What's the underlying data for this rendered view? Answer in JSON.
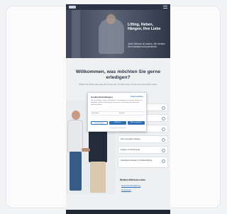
{
  "hero": {
    "title": "Lifting, Heben, Hängen, Ihre Liebe",
    "subtitle": "Jeder Mensch ist anders. Wir beraten Sie individuell und persönlich."
  },
  "main": {
    "welcome": "Willkommen, was möchten Sie gerne erledigen?",
    "intro": "Wählen Sie einfach das passende Thema aus, wir helfen Ihnen schnell und unkompliziert weiter."
  },
  "options": [
    {
      "label": "Beratungstermin vereinbaren"
    },
    {
      "label": "Rückruf anfordern"
    },
    {
      "label": "Unterlagen einreichen"
    },
    {
      "label": "Ihren Kontakt mitteilen"
    },
    {
      "label": "Fragen zur Rechnung"
    },
    {
      "label": "Sonstiges Anliegen zur Behandlung"
    }
  ],
  "links": {
    "heading": "Weitere hilfreiche Links",
    "items": [
      "Datenschutzerklärung",
      "Impressum"
    ]
  },
  "consent": {
    "title": "Cookie-Einstellungen",
    "brand": "Usercentrics",
    "text": "Wir verwenden Cookies und ähnliche Technologien, um unsere Website zu betreiben und Ihre Erfahrung zu verbessern. Sie können Ihre Auswahl jederzeit ändern.",
    "row_left": "Notwendig",
    "row_right": "Statistik",
    "btn_settings": "Einstellungen",
    "btn_deny": "Ablehnen",
    "btn_accept": "Alle akzeptieren",
    "footer": "Datenschutz · Impressum"
  },
  "colors": {
    "accent": "#2f6fb3",
    "dark": "#2b3444"
  }
}
